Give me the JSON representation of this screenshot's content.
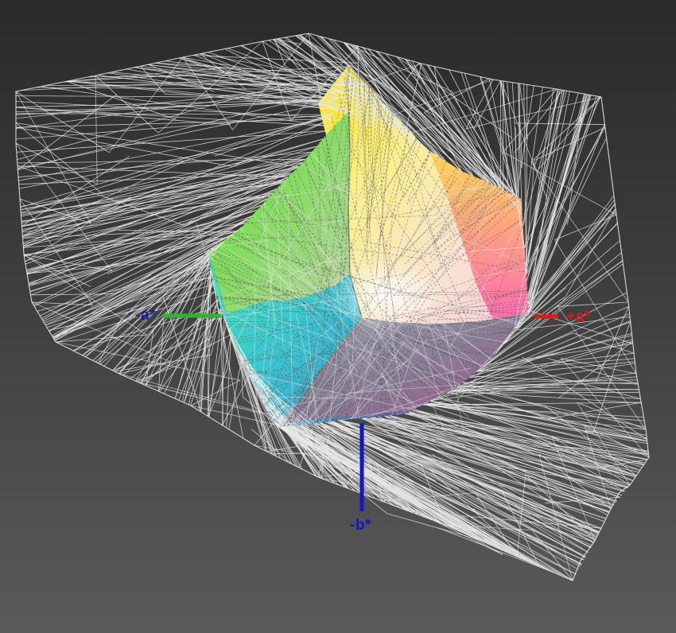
{
  "axes": {
    "neg_a": {
      "label": "-a*",
      "color": "#2db52d",
      "label_color": "#1a1aa8"
    },
    "pos_a": {
      "label": "+a*",
      "color": "#e01818",
      "label_color": "#e01818"
    },
    "neg_b": {
      "label": "-b*",
      "color": "#1414c8",
      "label_color": "#1414c8"
    }
  },
  "colors": {
    "background_top": "#2a2a2a",
    "background_bottom": "#5a5a5a",
    "wireframe": "#e8e8e8"
  }
}
